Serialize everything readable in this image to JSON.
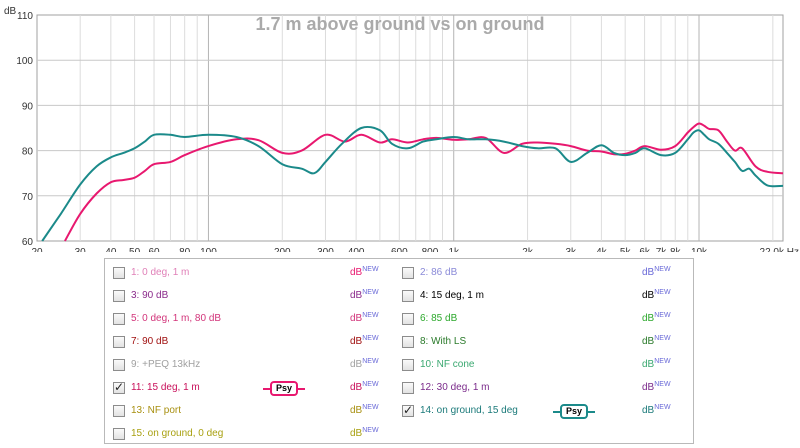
{
  "chart_data": {
    "type": "line",
    "title": "1.7 m above ground vs on ground",
    "xscale": "log",
    "xlim": [
      20,
      22000
    ],
    "ylim": [
      60,
      110
    ],
    "y_unit": "dB",
    "x_unit": "Hz",
    "grid": true,
    "y_ticks": [
      60,
      70,
      80,
      90,
      100,
      110
    ],
    "x_ticks": [
      {
        "v": 20,
        "t": "20"
      },
      {
        "v": 30,
        "t": "30"
      },
      {
        "v": 40,
        "t": "40"
      },
      {
        "v": 50,
        "t": "50"
      },
      {
        "v": 60,
        "t": "60"
      },
      {
        "v": 80,
        "t": "80"
      },
      {
        "v": 100,
        "t": "100"
      },
      {
        "v": 200,
        "t": "200"
      },
      {
        "v": 300,
        "t": "300"
      },
      {
        "v": 400,
        "t": "400"
      },
      {
        "v": 600,
        "t": "600"
      },
      {
        "v": 800,
        "t": "800"
      },
      {
        "v": 1000,
        "t": "1k"
      },
      {
        "v": 2000,
        "t": "2k"
      },
      {
        "v": 3000,
        "t": "3k"
      },
      {
        "v": 4000,
        "t": "4k"
      },
      {
        "v": 5000,
        "t": "5k"
      },
      {
        "v": 6000,
        "t": "6k"
      },
      {
        "v": 7000,
        "t": "7k"
      },
      {
        "v": 8000,
        "t": "8k"
      },
      {
        "v": 10000,
        "t": "10k"
      },
      {
        "v": 22000,
        "t": "22,0k Hz"
      }
    ],
    "series": [
      {
        "name": "11: 15 deg, 1 m",
        "color": "#e8186f",
        "x": [
          26,
          30,
          35,
          40,
          45,
          50,
          55,
          60,
          70,
          80,
          100,
          130,
          160,
          200,
          240,
          300,
          360,
          420,
          500,
          560,
          650,
          750,
          850,
          1000,
          1150,
          1350,
          1600,
          1900,
          2200,
          2600,
          3000,
          3500,
          4000,
          4500,
          5000,
          5500,
          6000,
          7000,
          8000,
          9000,
          9500,
          10000,
          10500,
          11000,
          12000,
          13000,
          14000,
          15000,
          17000,
          19000,
          22000
        ],
        "y": [
          60,
          66,
          70.5,
          73,
          73.5,
          74,
          75.5,
          77,
          77.5,
          79,
          81,
          82.5,
          82.3,
          79.5,
          80,
          83.5,
          82,
          83.5,
          81.8,
          82.5,
          81.8,
          82.5,
          82.8,
          82.4,
          82.5,
          82.8,
          79.5,
          81.5,
          81.8,
          81.5,
          81,
          80,
          79.8,
          79.2,
          79.3,
          80,
          81,
          80.2,
          81,
          84,
          85.2,
          86,
          85.5,
          84.8,
          84.5,
          82,
          80,
          80.5,
          76.5,
          75.3,
          75
        ]
      },
      {
        "name": "14: on ground, 15 deg",
        "color": "#1b8a8a",
        "x": [
          21,
          25,
          30,
          35,
          40,
          45,
          50,
          55,
          60,
          70,
          80,
          100,
          130,
          160,
          200,
          240,
          270,
          300,
          350,
          420,
          500,
          560,
          650,
          750,
          850,
          1000,
          1150,
          1350,
          1600,
          1900,
          2200,
          2600,
          3000,
          3500,
          4000,
          4500,
          5000,
          5500,
          6000,
          7000,
          8000,
          9000,
          9500,
          10000,
          10500,
          11000,
          12000,
          13000,
          14000,
          15000,
          16000,
          17000,
          19000,
          22000
        ],
        "y": [
          60,
          66,
          72.5,
          76.5,
          78.5,
          79.5,
          80.5,
          82,
          83.5,
          83.5,
          83,
          83.5,
          83,
          81,
          77,
          76,
          75,
          77.5,
          81.5,
          85,
          84.5,
          81.5,
          80.5,
          82,
          82.5,
          83,
          82.5,
          82.5,
          82,
          81,
          80.5,
          80.5,
          77.5,
          79.5,
          81.2,
          79.5,
          79,
          79.5,
          80.5,
          79,
          79.5,
          82.5,
          84,
          84.5,
          83.5,
          82.5,
          81.5,
          79.5,
          77.5,
          75.5,
          76,
          74.5,
          72.3,
          72.2
        ]
      }
    ]
  },
  "legend": {
    "items": [
      {
        "label": "1: 0 deg, 1 m",
        "checked": false,
        "color": "#e080b8",
        "db_color": "#e8186f",
        "psy": false
      },
      {
        "label": "2: 86 dB",
        "checked": false,
        "color": "#8a8ad8",
        "db_color": "#6a6ad8",
        "psy": false
      },
      {
        "label": "3: 90 dB",
        "checked": false,
        "color": "#8b2a8b",
        "db_color": "#8b2a8b",
        "psy": false
      },
      {
        "label": "4: 15 deg, 1 m",
        "checked": false,
        "color": "#000000",
        "db_color": "#000000",
        "psy": false
      },
      {
        "label": "5: 0 deg, 1 m, 80 dB",
        "checked": false,
        "color": "#d2347a",
        "db_color": "#d2347a",
        "psy": false
      },
      {
        "label": "6: 85 dB",
        "checked": false,
        "color": "#2ca82c",
        "db_color": "#2ca82c",
        "psy": false
      },
      {
        "label": "7: 90 dB",
        "checked": false,
        "color": "#a01010",
        "db_color": "#a01010",
        "psy": false
      },
      {
        "label": "8: With LS",
        "checked": false,
        "color": "#2a7a2a",
        "db_color": "#2a7a2a",
        "psy": false
      },
      {
        "label": "9: +PEQ 13kHz",
        "checked": false,
        "color": "#a0a0a0",
        "db_color": "#a0a0a0",
        "psy": false
      },
      {
        "label": "10: NF cone",
        "checked": false,
        "color": "#3aa870",
        "db_color": "#3aa870",
        "psy": false
      },
      {
        "label": "11: 15 deg, 1 m",
        "checked": true,
        "color": "#c8105a",
        "db_color": "#c8105a",
        "psy": true,
        "psy_label": "Psy",
        "psy_color": "#e8186f"
      },
      {
        "label": "12: 30 deg, 1 m",
        "checked": false,
        "color": "#7a2a8a",
        "db_color": "#7a2a8a",
        "psy": false
      },
      {
        "label": "13: NF port",
        "checked": false,
        "color": "#a89010",
        "db_color": "#a89010",
        "psy": false
      },
      {
        "label": "14: on ground, 15 deg",
        "checked": true,
        "color": "#1b7a7a",
        "db_color": "#1b7a7a",
        "psy": true,
        "psy_label": "Psy",
        "psy_color": "#1b8a8a"
      },
      {
        "label": "15: on ground, 0 deg",
        "checked": false,
        "color": "#a8a010",
        "db_color": "#a8a010",
        "psy": false
      }
    ],
    "db_label": "dB",
    "new_label": "NEW"
  }
}
